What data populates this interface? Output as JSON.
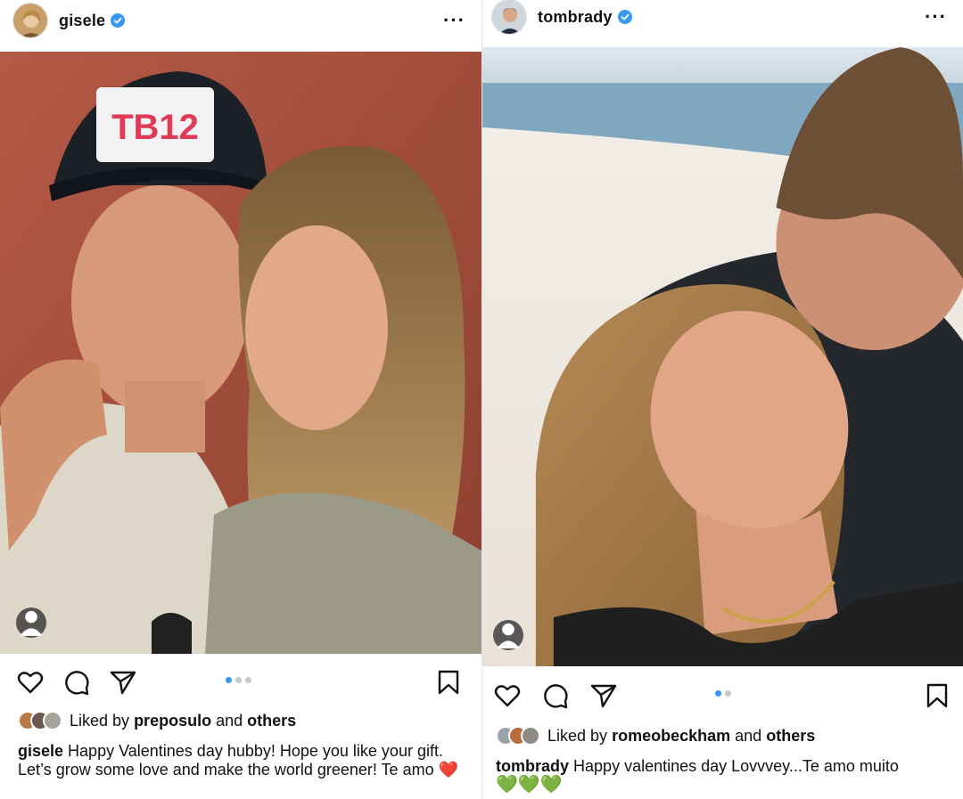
{
  "left_post": {
    "username": "gisele",
    "likes_prefix": "Liked by",
    "liked_by": "preposulo",
    "likes_and": "and",
    "likes_others": "others",
    "caption_user": "gisele",
    "caption_text": "Happy Valentines day hubby! Hope you like your gift. Let’s grow some love and make the world greener! Te amo ❤️",
    "photo_text": "TB12",
    "carousel_total": 3,
    "carousel_index": 1
  },
  "right_post": {
    "username": "tombrady",
    "likes_prefix": "Liked by",
    "liked_by": "romeobeckham",
    "likes_and": "and",
    "likes_others": "others",
    "caption_user": "tombrady",
    "caption_text": "Happy valentines day Lovvvey...Te amo muito",
    "caption_emoji": "💚💚💚",
    "carousel_total": 2,
    "carousel_index": 1
  },
  "icons": {
    "like": "heart-icon",
    "comment": "comment-icon",
    "share": "send-icon",
    "save": "bookmark-icon",
    "more": "more-options-icon",
    "verified": "verified-badge-icon",
    "tags": "user-tag-icon"
  },
  "colors": {
    "verified_blue": "#3897f0",
    "active_dot": "#3897f0",
    "inactive_dot": "#c8c8c8",
    "heart_red": "#ed4956",
    "green_heart": "#3cc13b"
  }
}
